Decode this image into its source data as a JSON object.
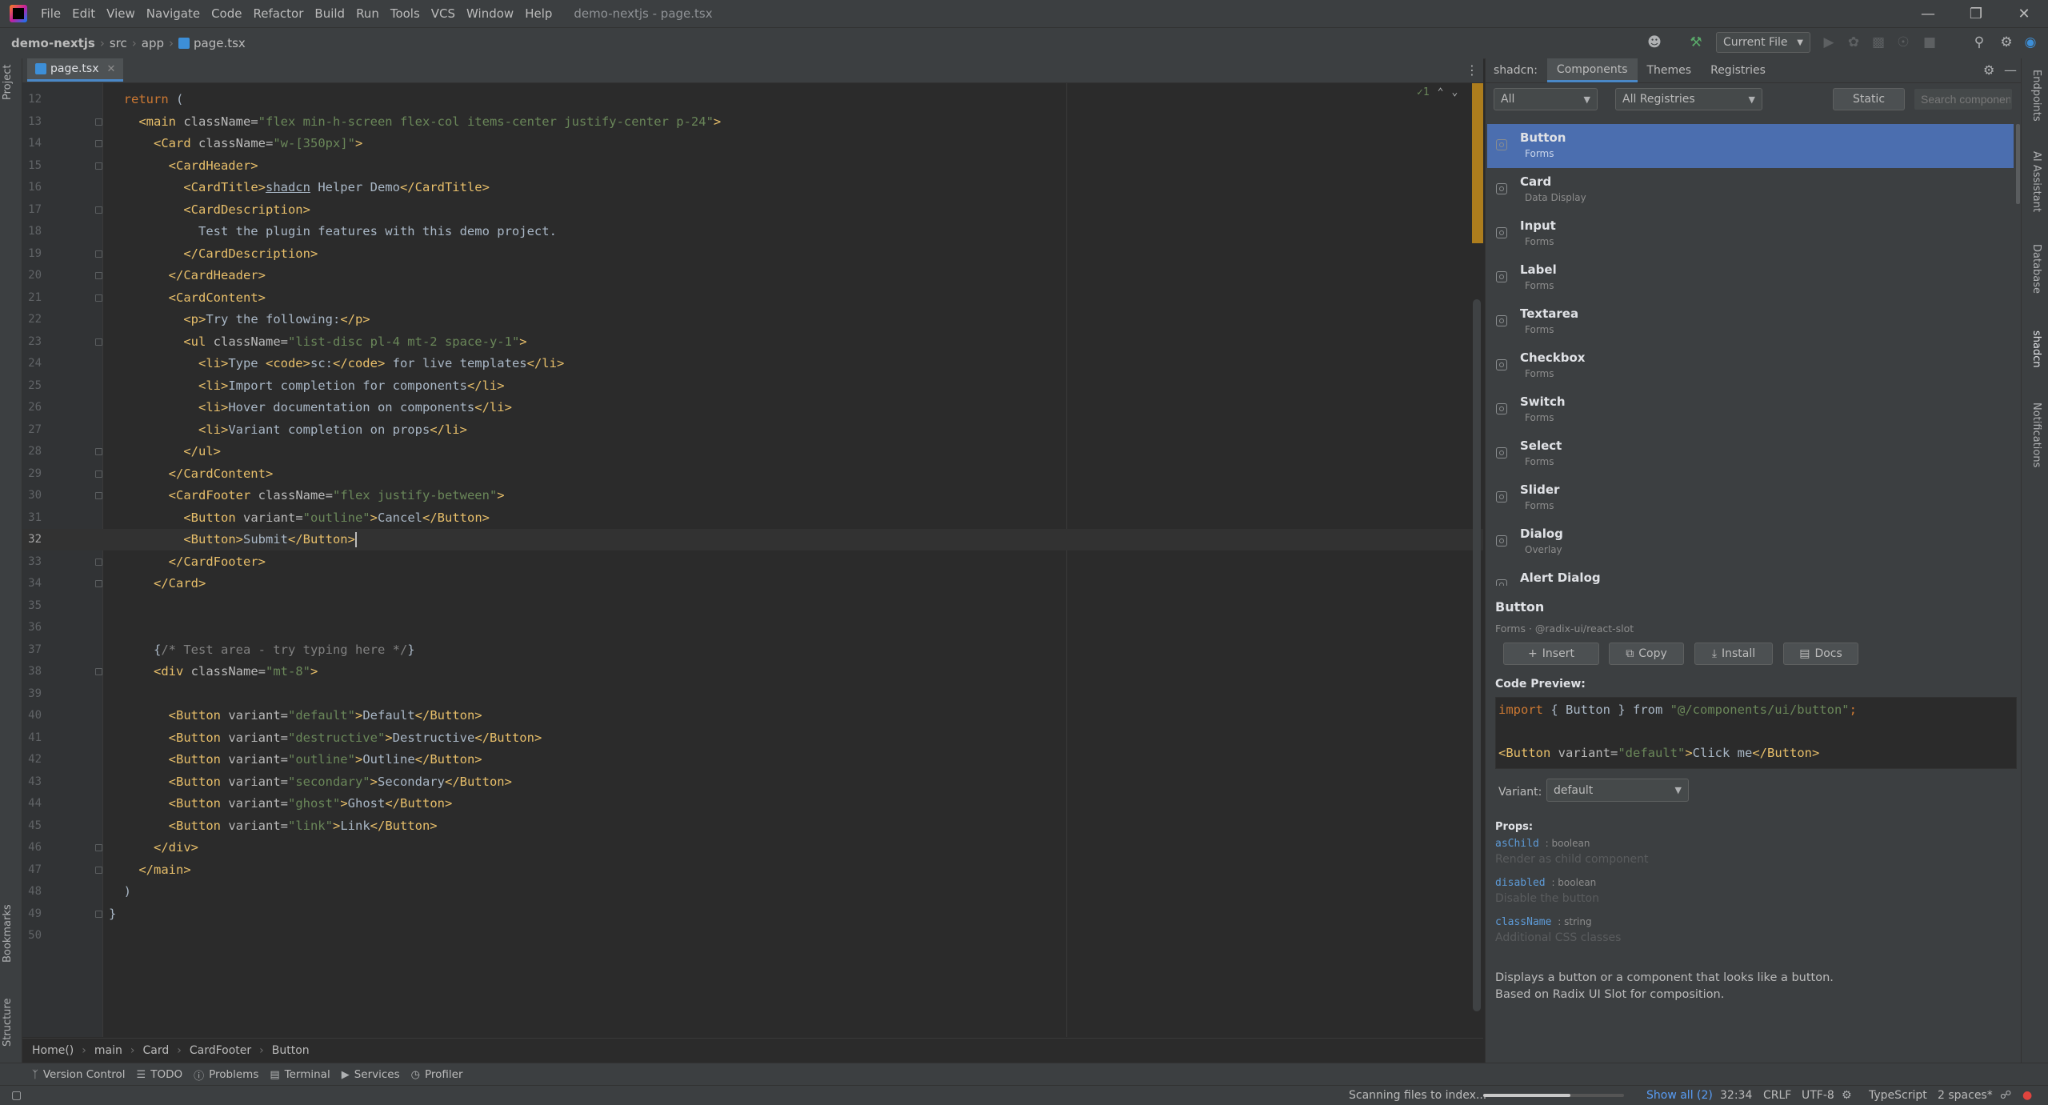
{
  "menubar": {
    "items": [
      "File",
      "Edit",
      "View",
      "Navigate",
      "Code",
      "Refactor",
      "Build",
      "Run",
      "Tools",
      "VCS",
      "Window",
      "Help"
    ],
    "window_title": "demo-nextjs - page.tsx"
  },
  "navbar": {
    "project": "demo-nextjs",
    "path": [
      "src",
      "app"
    ],
    "file": "page.tsx",
    "run_config": "Current File"
  },
  "left_strip": {
    "top": "Project",
    "bottom1": "Bookmarks",
    "bottom2": "Structure"
  },
  "editor": {
    "tab": "page.tsx",
    "inspection_count": "1",
    "lines": [
      {
        "n": "12",
        "html": "  <span class=\"kw\">return</span> ("
      },
      {
        "n": "13",
        "html": "    <span class=\"tg\">&lt;main</span> <span class=\"at\">className=</span><span class=\"st\">\"flex min-h-screen flex-col items-center justify-center p-24\"</span><span class=\"tg\">&gt;</span>"
      },
      {
        "n": "14",
        "html": "      <span class=\"tg\">&lt;Card</span> <span class=\"at\">className=</span><span class=\"st\">\"w-[350px]\"</span><span class=\"tg\">&gt;</span>"
      },
      {
        "n": "15",
        "html": "        <span class=\"tg\">&lt;CardHeader&gt;</span>"
      },
      {
        "n": "16",
        "html": "          <span class=\"tg\">&lt;CardTitle&gt;</span><span class=\"tx\" style=\"text-decoration:underline\">shadcn</span> Helper Demo<span class=\"tg\">&lt;/CardTitle&gt;</span>"
      },
      {
        "n": "17",
        "html": "          <span class=\"tg\">&lt;CardDescription&gt;</span>"
      },
      {
        "n": "18",
        "html": "            Test the plugin features with this demo project."
      },
      {
        "n": "19",
        "html": "          <span class=\"tg\">&lt;/CardDescription&gt;</span>"
      },
      {
        "n": "20",
        "html": "        <span class=\"tg\">&lt;/CardHeader&gt;</span>"
      },
      {
        "n": "21",
        "html": "        <span class=\"tg\">&lt;CardContent&gt;</span>"
      },
      {
        "n": "22",
        "html": "          <span class=\"tg\">&lt;p&gt;</span>Try the following:<span class=\"tg\">&lt;/p&gt;</span>"
      },
      {
        "n": "23",
        "html": "          <span class=\"tg\">&lt;ul</span> <span class=\"at\">className=</span><span class=\"st\">\"list-disc pl-4 mt-2 space-y-1\"</span><span class=\"tg\">&gt;</span>"
      },
      {
        "n": "24",
        "html": "            <span class=\"tg\">&lt;li&gt;</span>Type <span class=\"tg\">&lt;code&gt;</span>sc:<span class=\"tg\">&lt;/code&gt;</span> for live templates<span class=\"tg\">&lt;/li&gt;</span>"
      },
      {
        "n": "25",
        "html": "            <span class=\"tg\">&lt;li&gt;</span>Import completion for components<span class=\"tg\">&lt;/li&gt;</span>"
      },
      {
        "n": "26",
        "html": "            <span class=\"tg\">&lt;li&gt;</span>Hover documentation on components<span class=\"tg\">&lt;/li&gt;</span>"
      },
      {
        "n": "27",
        "html": "            <span class=\"tg\">&lt;li&gt;</span>Variant completion on props<span class=\"tg\">&lt;/li&gt;</span>"
      },
      {
        "n": "28",
        "html": "          <span class=\"tg\">&lt;/ul&gt;</span>"
      },
      {
        "n": "29",
        "html": "        <span class=\"tg\">&lt;/CardContent&gt;</span>"
      },
      {
        "n": "30",
        "html": "        <span class=\"tg\">&lt;CardFooter</span> <span class=\"at\">className=</span><span class=\"st\">\"flex justify-between\"</span><span class=\"tg\">&gt;</span>"
      },
      {
        "n": "31",
        "html": "          <span class=\"tg\">&lt;Button</span> <span class=\"at\">variant=</span><span class=\"st\">\"outline\"</span><span class=\"tg\">&gt;</span>Cancel<span class=\"tg\">&lt;/Button&gt;</span>"
      },
      {
        "n": "32",
        "html": "          <span class=\"tg\">&lt;Button&gt;</span>Submit<span class=\"tg\">&lt;/Button&gt;</span><span class=\"caret\"></span>",
        "current": true
      },
      {
        "n": "33",
        "html": "        <span class=\"tg\">&lt;/CardFooter&gt;</span>"
      },
      {
        "n": "34",
        "html": "      <span class=\"tg\">&lt;/Card&gt;</span>"
      },
      {
        "n": "35",
        "html": ""
      },
      {
        "n": "36",
        "html": ""
      },
      {
        "n": "37",
        "html": "      {<span class=\"cm\">/* Test area - try typing here */</span>}"
      },
      {
        "n": "38",
        "html": "      <span class=\"tg\">&lt;div</span> <span class=\"at\">className=</span><span class=\"st\">\"mt-8\"</span><span class=\"tg\">&gt;</span>"
      },
      {
        "n": "39",
        "html": ""
      },
      {
        "n": "40",
        "html": "        <span class=\"tg\">&lt;Button</span> <span class=\"at\">variant=</span><span class=\"st\">\"default\"</span><span class=\"tg\">&gt;</span>Default<span class=\"tg\">&lt;/Button&gt;</span>"
      },
      {
        "n": "41",
        "html": "        <span class=\"tg\">&lt;Button</span> <span class=\"at\">variant=</span><span class=\"st\">\"destructive\"</span><span class=\"tg\">&gt;</span>Destructive<span class=\"tg\">&lt;/Button&gt;</span>"
      },
      {
        "n": "42",
        "html": "        <span class=\"tg\">&lt;Button</span> <span class=\"at\">variant=</span><span class=\"st\">\"outline\"</span><span class=\"tg\">&gt;</span>Outline<span class=\"tg\">&lt;/Button&gt;</span>"
      },
      {
        "n": "43",
        "html": "        <span class=\"tg\">&lt;Button</span> <span class=\"at\">variant=</span><span class=\"st\">\"secondary\"</span><span class=\"tg\">&gt;</span>Secondary<span class=\"tg\">&lt;/Button&gt;</span>"
      },
      {
        "n": "44",
        "html": "        <span class=\"tg\">&lt;Button</span> <span class=\"at\">variant=</span><span class=\"st\">\"ghost\"</span><span class=\"tg\">&gt;</span>Ghost<span class=\"tg\">&lt;/Button&gt;</span>"
      },
      {
        "n": "45",
        "html": "        <span class=\"tg\">&lt;Button</span> <span class=\"at\">variant=</span><span class=\"st\">\"link\"</span><span class=\"tg\">&gt;</span>Link<span class=\"tg\">&lt;/Button&gt;</span>"
      },
      {
        "n": "46",
        "html": "      <span class=\"tg\">&lt;/div&gt;</span>"
      },
      {
        "n": "47",
        "html": "    <span class=\"tg\">&lt;/main&gt;</span>"
      },
      {
        "n": "48",
        "html": "  )"
      },
      {
        "n": "49",
        "html": "}"
      },
      {
        "n": "50",
        "html": ""
      }
    ],
    "breadcrumbs": [
      "Home()",
      "main",
      "Card",
      "CardFooter",
      "Button"
    ]
  },
  "toolwindows": [
    "Version Control",
    "TODO",
    "Problems",
    "Terminal",
    "Services",
    "Profiler"
  ],
  "status": {
    "message": "Scanning files to index...",
    "progress": 0.62,
    "show_all": "Show all (2)",
    "position": "32:34",
    "line_sep": "CRLF",
    "encoding": "UTF-8",
    "language": "TypeScript",
    "indent": "2 spaces*"
  },
  "shadcn": {
    "title": "shadcn:",
    "tabs": [
      "Components",
      "Themes",
      "Registries"
    ],
    "filter_category": "All",
    "filter_registry": "All Registries",
    "static_label": "Static",
    "search_placeholder": "Search components...",
    "components": [
      {
        "name": "Button",
        "category": "Forms"
      },
      {
        "name": "Card",
        "category": "Data Display"
      },
      {
        "name": "Input",
        "category": "Forms"
      },
      {
        "name": "Label",
        "category": "Forms"
      },
      {
        "name": "Textarea",
        "category": "Forms"
      },
      {
        "name": "Checkbox",
        "category": "Forms"
      },
      {
        "name": "Switch",
        "category": "Forms"
      },
      {
        "name": "Select",
        "category": "Forms"
      },
      {
        "name": "Slider",
        "category": "Forms"
      },
      {
        "name": "Dialog",
        "category": "Overlay"
      },
      {
        "name": "Alert Dialog",
        "category": ""
      }
    ],
    "detail": {
      "name": "Button",
      "meta": "Forms · @radix-ui/react-slot",
      "buttons": [
        "Insert",
        "Copy",
        "Install",
        "Docs"
      ],
      "code_preview_label": "Code Preview:",
      "variant_label": "Variant:",
      "variant_value": "default",
      "props_label": "Props:",
      "props": [
        {
          "name": "asChild",
          "type": ": boolean",
          "desc": "Render as child component"
        },
        {
          "name": "disabled",
          "type": ": boolean",
          "desc": "Disable the button"
        },
        {
          "name": "className",
          "type": ": string",
          "desc": "Additional CSS classes"
        }
      ],
      "description1": "Displays a button or a component that looks like a button.",
      "description2": "Based on Radix UI Slot for composition."
    }
  },
  "right_strip": [
    "Endpoints",
    "AI Assistant",
    "Database",
    "shadcn",
    "Notifications"
  ]
}
